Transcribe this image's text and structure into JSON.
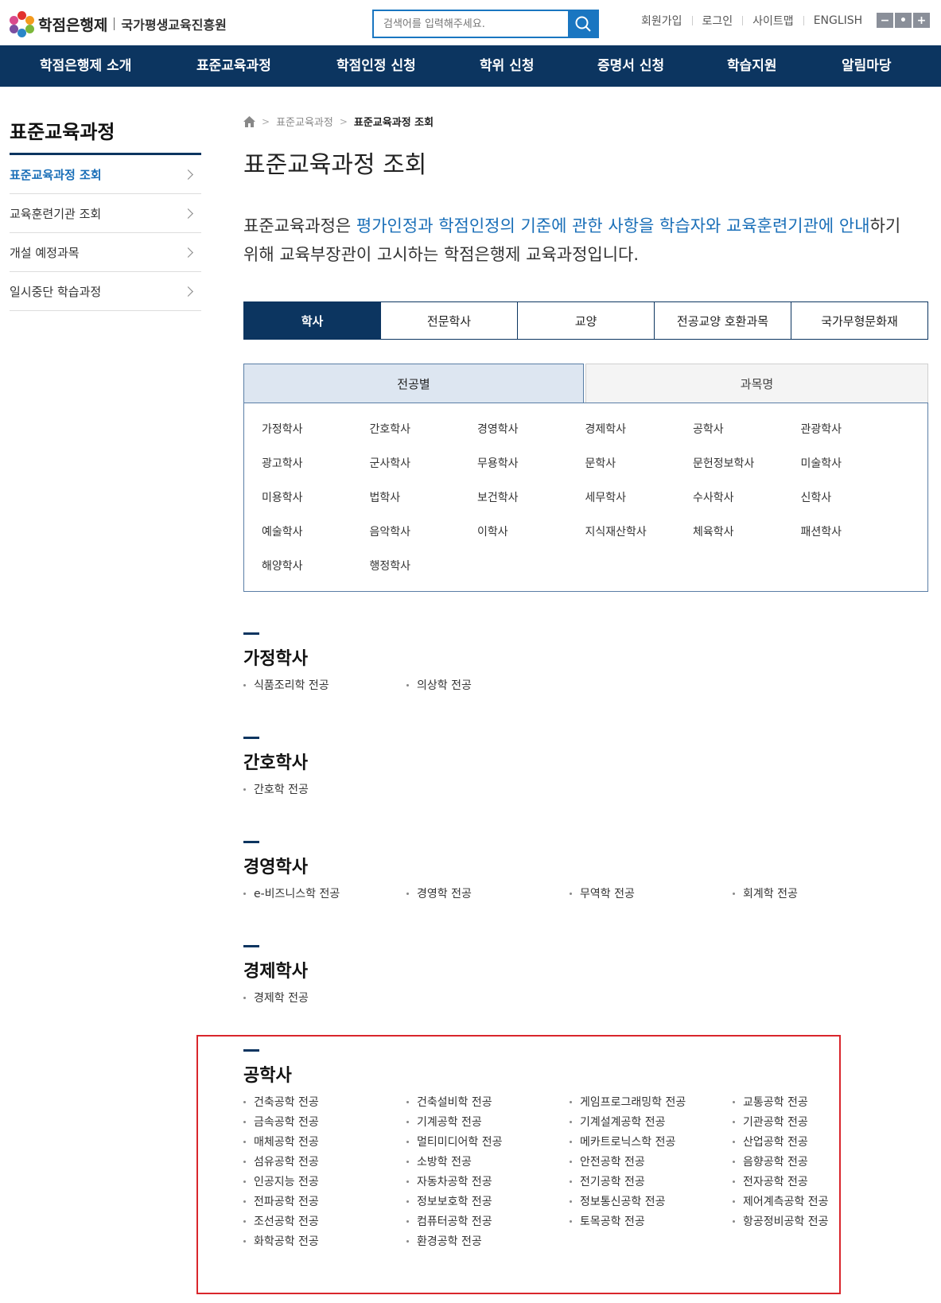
{
  "header": {
    "logo_main": "학점은행제",
    "logo_org": "국가평생교육진흥원",
    "search_placeholder": "검색어를 입력해주세요.",
    "util_links": [
      "회원가입",
      "로그인",
      "사이트맵",
      "ENGLISH"
    ],
    "zoom_buttons": [
      "−",
      "•",
      "+"
    ]
  },
  "gnb": [
    "학점은행제 소개",
    "표준교육과정",
    "학점인정 신청",
    "학위 신청",
    "증명서 신청",
    "학습지원",
    "알림마당"
  ],
  "sidebar": {
    "title": "표준교육과정",
    "items": [
      "표준교육과정 조회",
      "교육훈련기관 조회",
      "개설 예정과목",
      "일시중단 학습과정"
    ]
  },
  "breadcrumb": [
    "표준교육과정",
    "표준교육과정 조회"
  ],
  "page_title": "표준교육과정 조회",
  "intro": {
    "p1": "표준교육과정은 ",
    "h1": "평가인정과 학점인정의 기준에 관한 사항을 학습자와 교육훈련기관에 안내",
    "p2": "하기 위해 교육부장관이 고시하는 학점은행제 교육과정입니다."
  },
  "tabs": [
    "학사",
    "전문학사",
    "교양",
    "전공교양 호환과목",
    "국가무형문화재"
  ],
  "subtabs": [
    "전공별",
    "과목명"
  ],
  "degrees": [
    "가정학사",
    "간호학사",
    "경영학사",
    "경제학사",
    "공학사",
    "관광학사",
    "광고학사",
    "군사학사",
    "무용학사",
    "문학사",
    "문헌정보학사",
    "미술학사",
    "미용학사",
    "법학사",
    "보건학사",
    "세무학사",
    "수사학사",
    "신학사",
    "예술학사",
    "음악학사",
    "이학사",
    "지식재산학사",
    "체육학사",
    "패션학사",
    "해양학사",
    "행정학사"
  ],
  "sections": [
    {
      "title": "가정학사",
      "majors": [
        "식품조리학 전공",
        "의상학 전공"
      ]
    },
    {
      "title": "간호학사",
      "majors": [
        "간호학 전공"
      ]
    },
    {
      "title": "경영학사",
      "majors": [
        "e-비즈니스학 전공",
        "경영학 전공",
        "무역학 전공",
        "회계학 전공"
      ]
    },
    {
      "title": "경제학사",
      "majors": [
        "경제학 전공"
      ]
    },
    {
      "title": "공학사",
      "majors": [
        "건축공학 전공",
        "건축설비학 전공",
        "게임프로그래밍학 전공",
        "교통공학 전공",
        "금속공학 전공",
        "기계공학 전공",
        "기계설계공학 전공",
        "기관공학 전공",
        "매체공학 전공",
        "멀티미디어학 전공",
        "메카트로닉스학 전공",
        "산업공학 전공",
        "섬유공학 전공",
        "소방학 전공",
        "안전공학 전공",
        "음향공학 전공",
        "인공지능 전공",
        "자동차공학 전공",
        "전기공학 전공",
        "전자공학 전공",
        "전파공학 전공",
        "정보보호학 전공",
        "정보통신공학 전공",
        "제어계측공학 전공",
        "조선공학 전공",
        "컴퓨터공학 전공",
        "토목공학 전공",
        "항공정비공학 전공",
        "화학공학 전공",
        "환경공학 전공"
      ]
    }
  ]
}
